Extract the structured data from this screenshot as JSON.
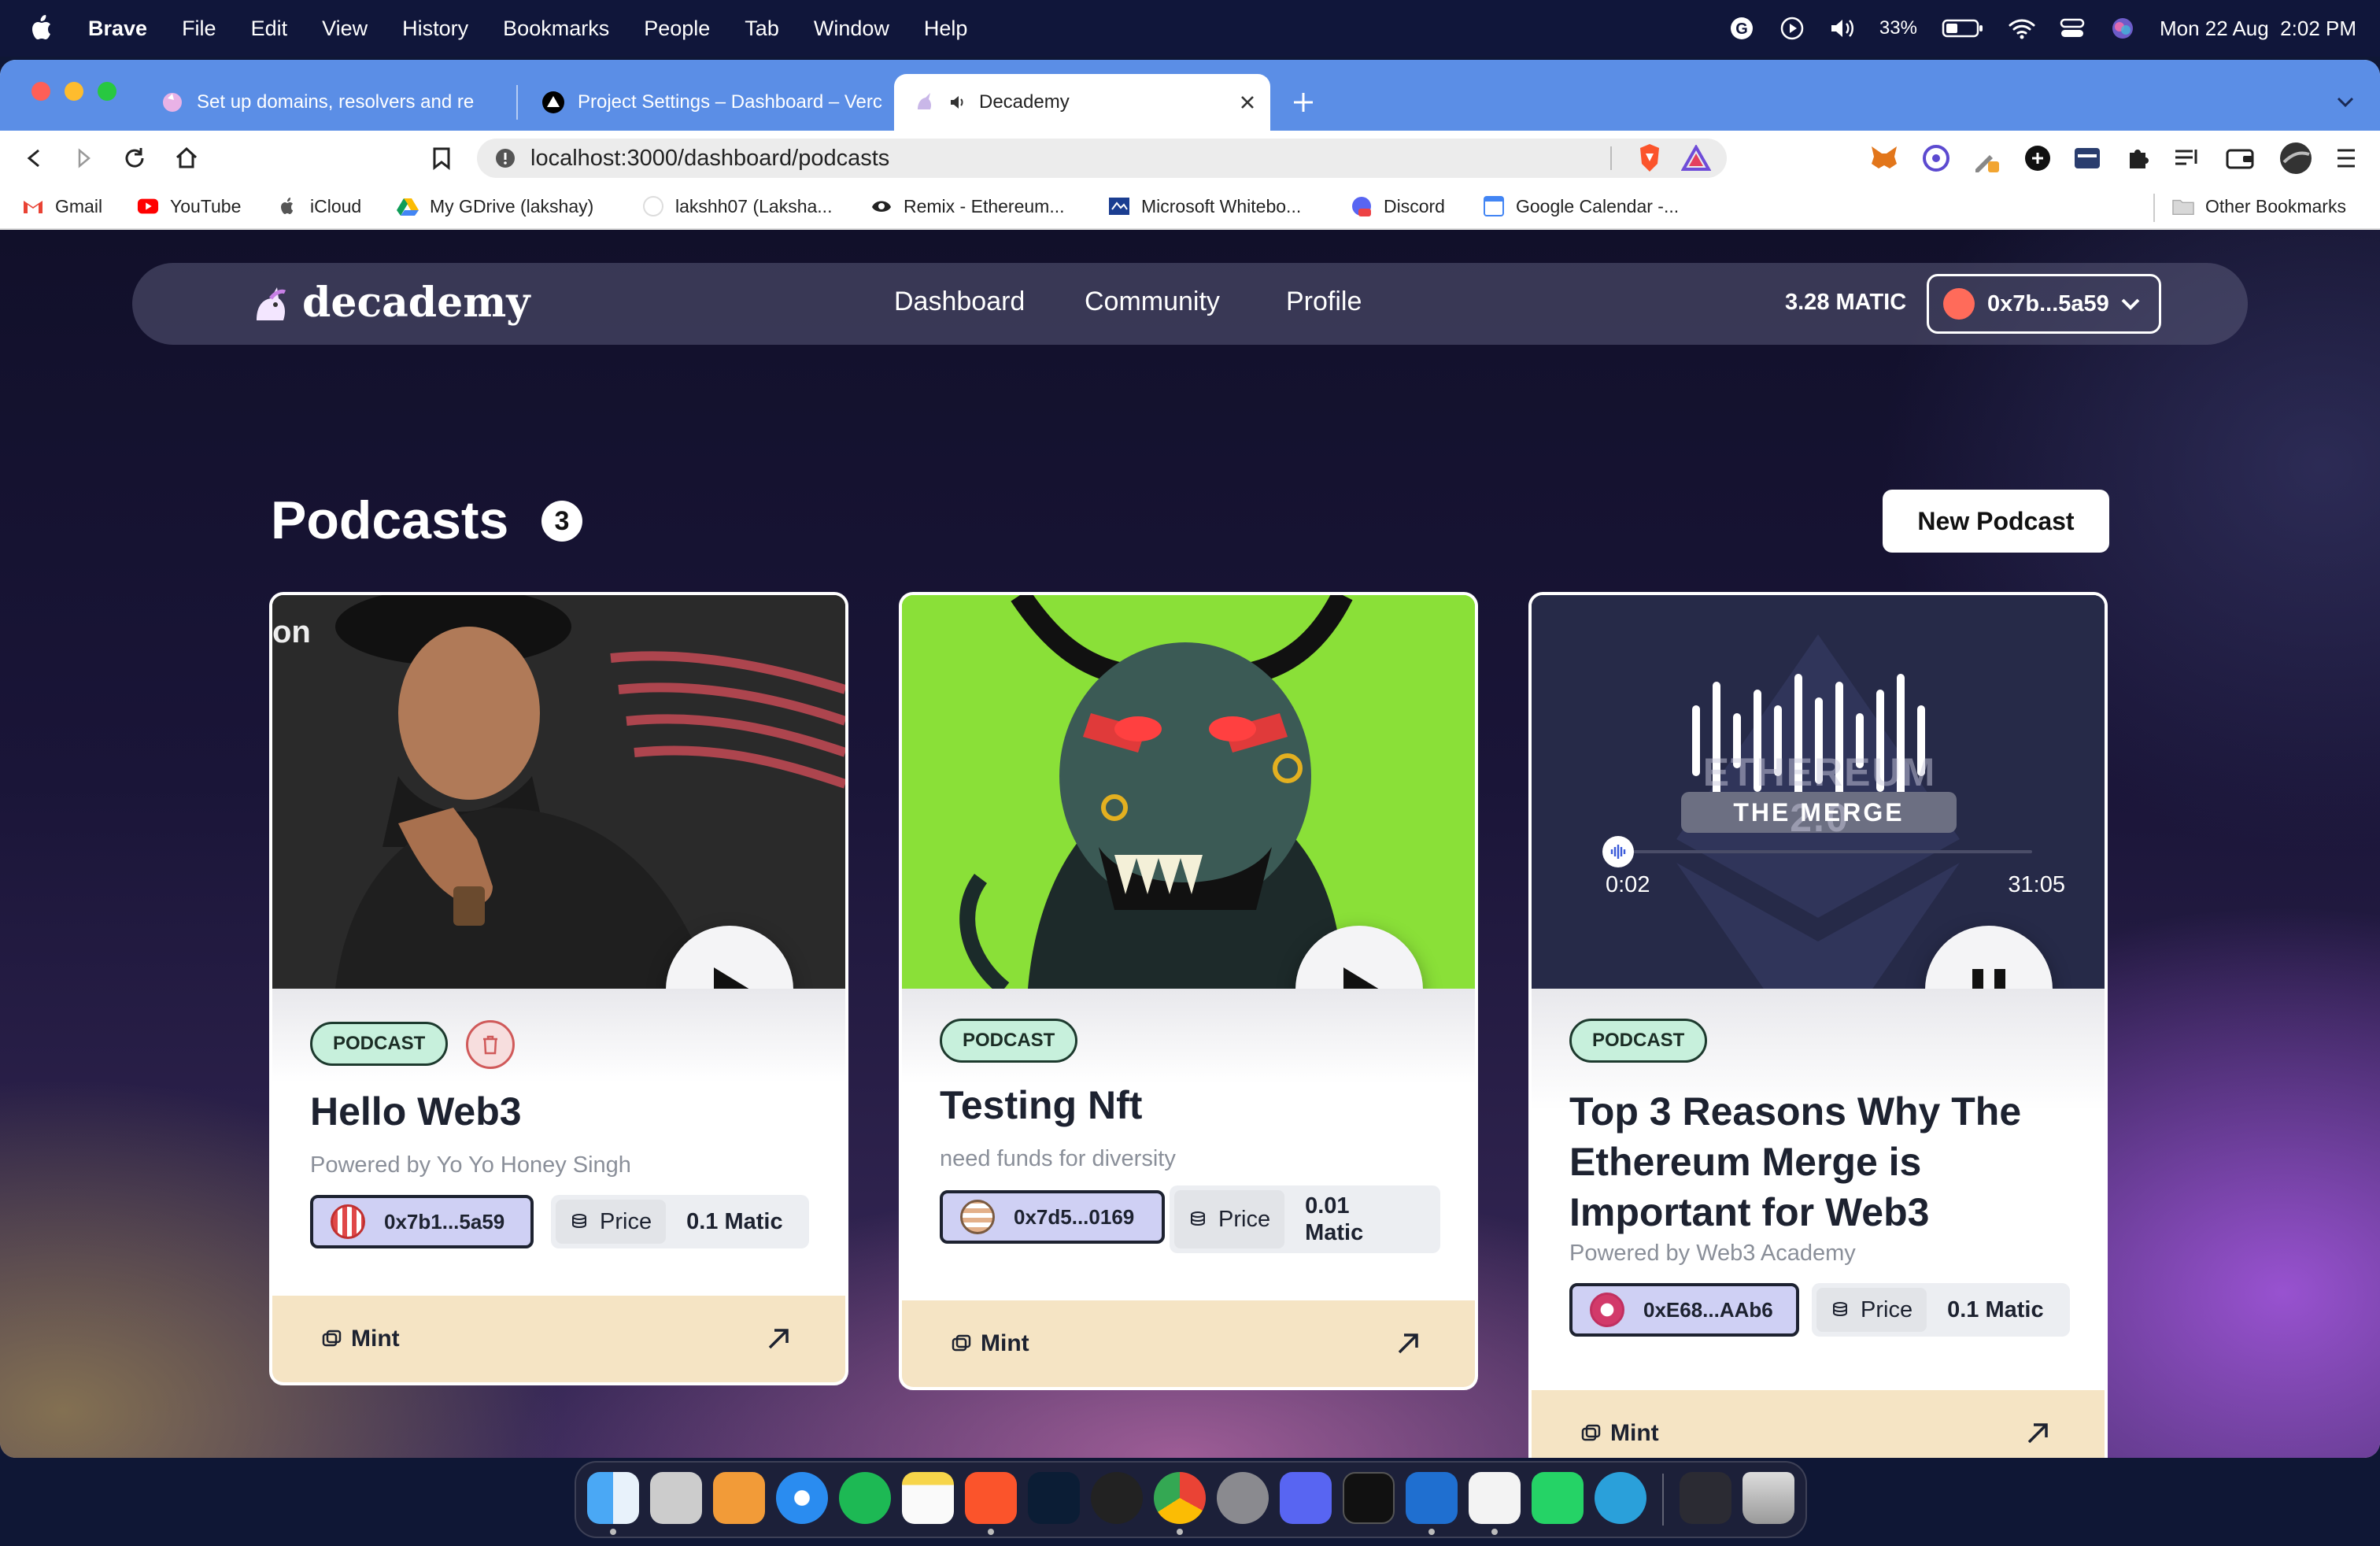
{
  "menubar": {
    "app": "Brave",
    "items": [
      "File",
      "Edit",
      "View",
      "History",
      "Bookmarks",
      "People",
      "Tab",
      "Window",
      "Help"
    ],
    "battery": "33%",
    "datetime": "Mon 22 Aug  2:02 PM"
  },
  "browser": {
    "tabs": [
      {
        "label": "Set up domains, resolvers and re",
        "active": false
      },
      {
        "label": "Project Settings – Dashboard – Verc",
        "active": false
      },
      {
        "label": "Decademy",
        "active": true
      }
    ],
    "url": "localhost:3000/dashboard/podcasts",
    "bookmarks": [
      "Gmail",
      "YouTube",
      "iCloud",
      "My GDrive (lakshay)",
      "lakshh07 (Laksha...",
      "Remix - Ethereum...",
      "Microsoft Whitebo...",
      "Discord",
      "Google Calendar -..."
    ],
    "other_bookmarks": "Other Bookmarks"
  },
  "nav": {
    "brand": "decademy",
    "links": [
      "Dashboard",
      "Community",
      "Profile"
    ],
    "balance": "3.28 MATIC",
    "wallet": "0x7b...5a59"
  },
  "page": {
    "title": "Podcasts",
    "count": "3",
    "new_button": "New Podcast"
  },
  "podcasts": [
    {
      "tag": "PODCAST",
      "title": "Hello Web3",
      "subtitle": "Powered by Yo Yo Honey Singh",
      "creator": "0x7b1...5a59",
      "price_label": "Price",
      "price": "0.1 Matic",
      "mint_label": "Mint",
      "state": "paused"
    },
    {
      "tag": "PODCAST",
      "title": "Testing Nft",
      "subtitle": "need funds for diversity",
      "creator": "0x7d5...0169",
      "price_label": "Price",
      "price": "0.01 Matic",
      "mint_label": "Mint",
      "state": "paused"
    },
    {
      "tag": "PODCAST",
      "title": "Top 3 Reasons Why The Ethereum Merge is Important for Web3",
      "subtitle": "Powered by Web3 Academy",
      "creator": "0xE68...AAb6",
      "price_label": "Price",
      "price": "0.1 Matic",
      "mint_label": "Mint",
      "state": "playing",
      "player": {
        "elapsed": "0:02",
        "duration": "31:05",
        "progress": 0.001
      },
      "artwork_text": [
        "ETHEREUM 2.0",
        "THE MERGE"
      ]
    }
  ],
  "colors": {
    "tag_bg": "#c7f0dc",
    "address_bg": "#cfd0f4",
    "mint_bg": "#f5e4c4",
    "tabbar": "#5b8ee6"
  }
}
